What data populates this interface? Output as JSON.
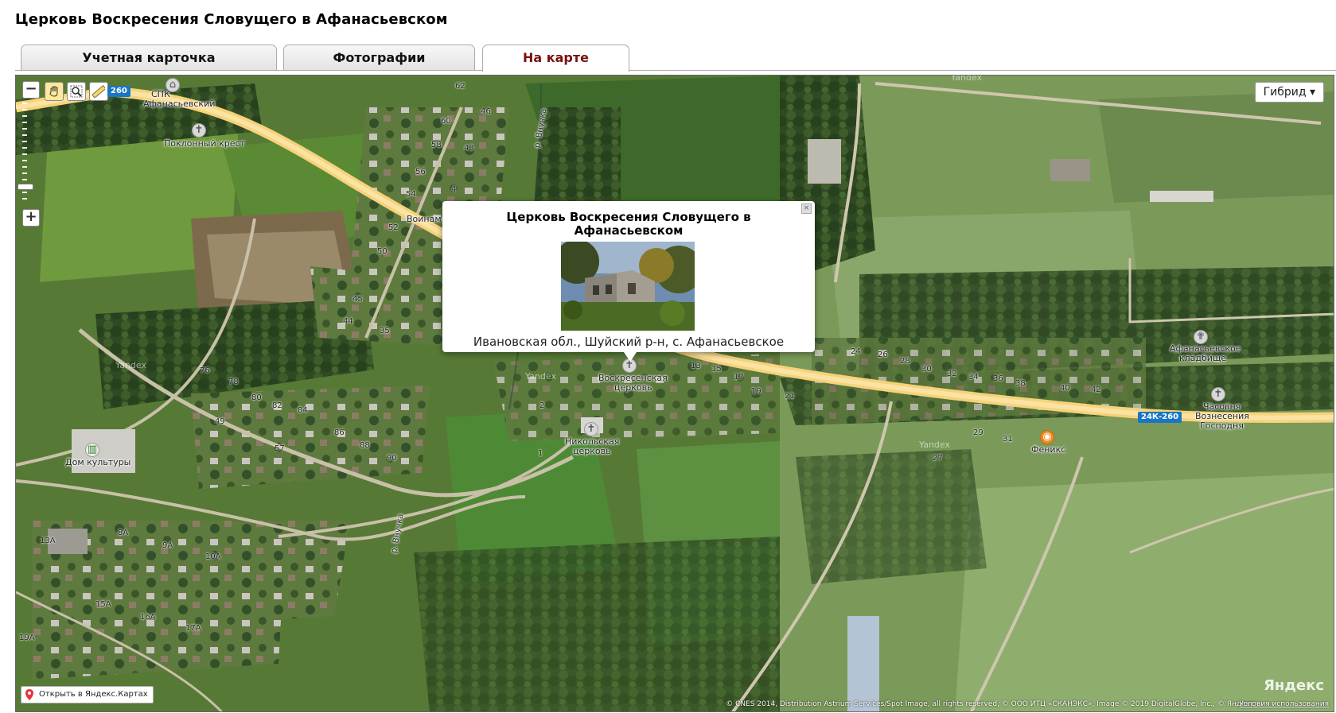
{
  "page": {
    "title": "Церковь Воскресения Словущего в Афанасьевском"
  },
  "tabs": [
    {
      "label": "Учетная карточка",
      "active": false
    },
    {
      "label": "Фотографии",
      "active": false
    },
    {
      "label": "На карте",
      "active": true
    }
  ],
  "map": {
    "layer_button": "Гибрид ▾",
    "labels": {
      "spk": "СПК",
      "spk2": "Афанасьевский",
      "cross": "Поклонный крест",
      "voinam": "Воинам-",
      "voskres": "Воскресенская",
      "voskres2": "церковь",
      "nikol": "Никольская",
      "nikol2": "церковь",
      "dk": "Дом культуры",
      "cemetery": "Афанасьевское",
      "cemetery2": "кладбище",
      "chapel": "Часовня",
      "chapel2": "Вознесения",
      "chapel3": "Господня",
      "feniks": "Феникс",
      "river1": "р. Внучка",
      "river2": "р. Внучка"
    },
    "road_shields": {
      "r260a": "260",
      "r260b": "24К-260"
    },
    "house_numbers": [
      "62",
      "46",
      "60",
      "58",
      "43",
      "56",
      "4",
      "54",
      "52",
      "50",
      "45",
      "44",
      "35",
      "76",
      "78",
      "80",
      "82",
      "84",
      "86",
      "88",
      "90",
      "49",
      "57",
      "13А",
      "8А",
      "9А",
      "10А",
      "15А",
      "16А",
      "17А",
      "19А",
      "2",
      "1",
      "13",
      "15",
      "17",
      "19",
      "21",
      "24",
      "26",
      "28",
      "30",
      "32",
      "34",
      "36",
      "38",
      "40",
      "42",
      "29",
      "31",
      "27",
      "35"
    ],
    "watermark": "Yandex",
    "open_button": "Открыть в Яндекс.Картах",
    "logo": "Яндекс",
    "copyright": "© CNES 2014, Distribution Astrium Services/Spot Image, all rights reserved, © ООО ИТЦ «СКАНЭКС», Image © 2019 DigitalGlobe, Inc., © Яндекс",
    "terms": "Условия использования"
  },
  "popup": {
    "title": "Церковь Воскресения Словущего в Афанасьевском",
    "address": "Ивановская обл., Шуйский р-н, с. Афанасьевское",
    "close": "×"
  }
}
